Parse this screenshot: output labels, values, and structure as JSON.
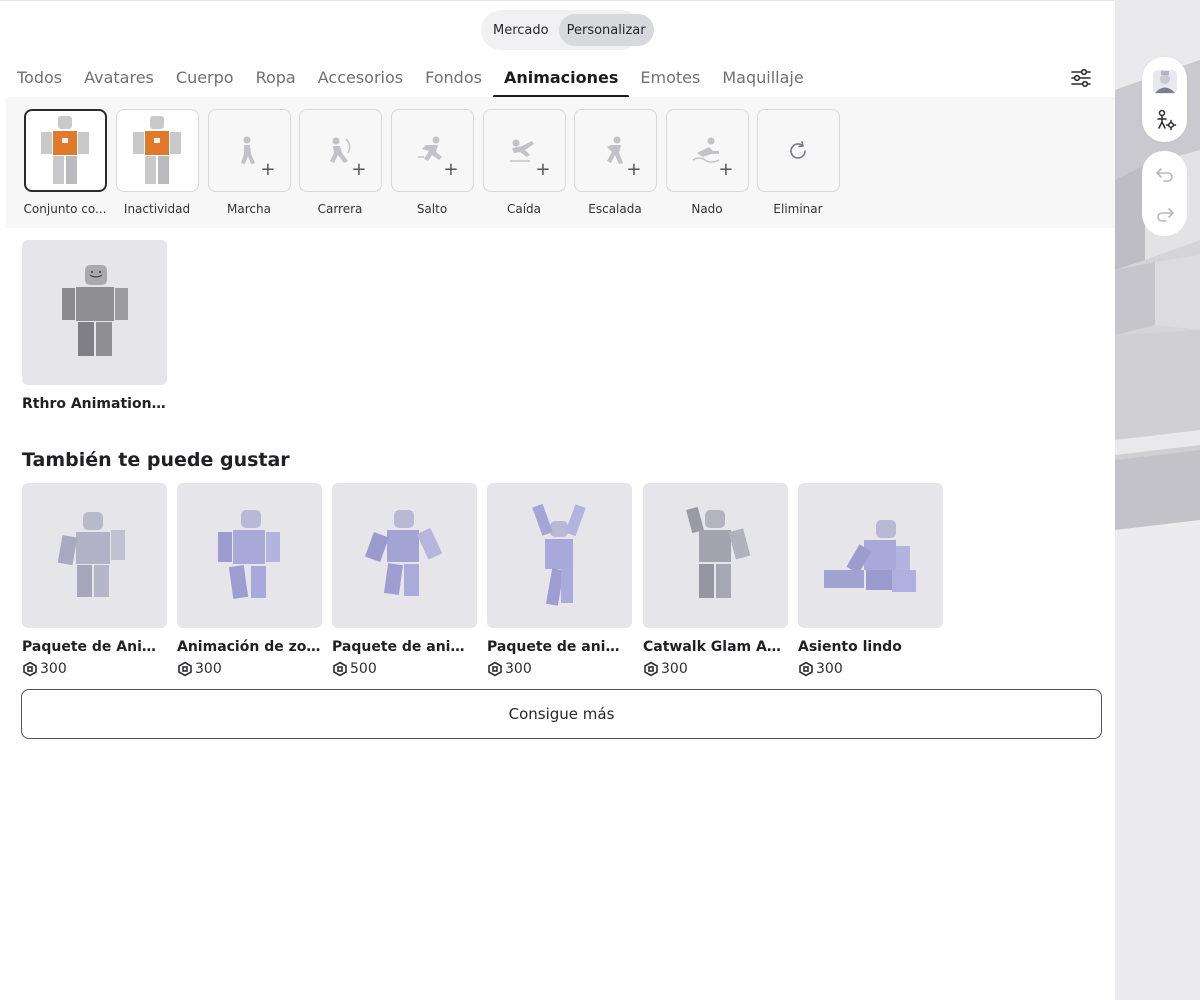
{
  "mode_toggle": {
    "options": [
      "Mercado",
      "Personalizar"
    ],
    "active": "Personalizar"
  },
  "tabs": [
    {
      "label": "Todos"
    },
    {
      "label": "Avatares"
    },
    {
      "label": "Cuerpo"
    },
    {
      "label": "Ropa"
    },
    {
      "label": "Accesorios"
    },
    {
      "label": "Fondos"
    },
    {
      "label": "Animaciones",
      "active": true
    },
    {
      "label": "Emotes"
    },
    {
      "label": "Maquillaje"
    }
  ],
  "slots": [
    {
      "label": "Conjunto co...",
      "icon": "avatar-thumbnail",
      "selected": true
    },
    {
      "label": "Inactividad",
      "icon": "avatar-thumbnail"
    },
    {
      "label": "Marcha",
      "icon": "walk-icon"
    },
    {
      "label": "Carrera",
      "icon": "run-icon"
    },
    {
      "label": "Salto",
      "icon": "jump-icon"
    },
    {
      "label": "Caída",
      "icon": "fall-icon"
    },
    {
      "label": "Escalada",
      "icon": "climb-icon"
    },
    {
      "label": "Nado",
      "icon": "swim-icon"
    },
    {
      "label": "Eliminar",
      "icon": "reset-icon"
    }
  ],
  "owned_items": [
    {
      "name": "Rthro Animation P..."
    }
  ],
  "suggestions": {
    "title": "También te puede gustar",
    "items": [
      {
        "name": "Paquete de Anima...",
        "price": "300"
      },
      {
        "name": "Animación de zom...",
        "price": "300"
      },
      {
        "name": "Paquete de anima...",
        "price": "500"
      },
      {
        "name": "Paquete de anima...",
        "price": "300"
      },
      {
        "name": "Catwalk Glam Ani...",
        "price": "300"
      },
      {
        "name": "Asiento lindo",
        "price": "300"
      }
    ]
  },
  "more_button_label": "Consigue más",
  "colors": {
    "active_tab": "#1b1c20",
    "card_bg": "#e6e6ea",
    "figure": "#b2b2c8"
  }
}
